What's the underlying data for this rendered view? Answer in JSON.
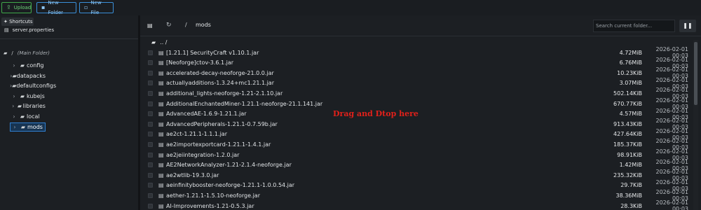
{
  "toolbar": {
    "upload_label": "Upload",
    "new_folder_label": "New Folder",
    "new_file_label": "New File"
  },
  "sidebar": {
    "shortcuts_label": "Shortcuts",
    "shortcut_item": "server.properties",
    "root_label": "/",
    "root_sub": "(Main Folder)",
    "tree": [
      {
        "label": "config"
      },
      {
        "label": "datapacks"
      },
      {
        "label": "defaultconfigs"
      },
      {
        "label": "kubejs"
      },
      {
        "label": "libraries"
      },
      {
        "label": "local"
      },
      {
        "label": "mods",
        "active": true
      }
    ]
  },
  "browser": {
    "crumb_sep": "/",
    "crumb_dir": "mods",
    "search_placeholder": "Search current folder...",
    "up_label": ".. /",
    "drop_hint": "Drag and Dtop here",
    "files": [
      {
        "name": "[1.21.1] SecurityCraft v1.10.1.jar",
        "size": "4.72MiB",
        "date": "2026-02-01 00:03"
      },
      {
        "name": "[Neoforge]ctov-3.6.1.jar",
        "size": "6.76MiB",
        "date": "2026-02-01 00:03"
      },
      {
        "name": "accelerated-decay-neoforge-21.0.0.jar",
        "size": "10.23KiB",
        "date": "2026-02-01 00:03"
      },
      {
        "name": "actuallyadditions-1.3.24+mc1.21.1.jar",
        "size": "3.07MiB",
        "date": "2026-02-01 00:03"
      },
      {
        "name": "additional_lights-neoforge-1.21-2.1.10.jar",
        "size": "502.14KiB",
        "date": "2026-02-01 00:03"
      },
      {
        "name": "AdditionalEnchantedMiner-1.21.1-neoforge-21.1.141.jar",
        "size": "670.77KiB",
        "date": "2026-02-01 00:03"
      },
      {
        "name": "AdvancedAE-1.6.9-1.21.1.jar",
        "size": "4.57MiB",
        "date": "2026-02-01 00:03"
      },
      {
        "name": "AdvancedPeripherals-1.21.1-0.7.59b.jar",
        "size": "913.43KiB",
        "date": "2026-02-01 00:03"
      },
      {
        "name": "ae2ct-1.21.1-1.1.1.jar",
        "size": "427.64KiB",
        "date": "2026-02-01 00:03"
      },
      {
        "name": "ae2importexportcard-1.21.1-1.4.1.jar",
        "size": "185.37KiB",
        "date": "2026-02-01 00:03"
      },
      {
        "name": "ae2jeiintegration-1.2.0.jar",
        "size": "98.91KiB",
        "date": "2026-02-01 00:03"
      },
      {
        "name": "AE2NetworkAnalyzer-1.21-2.1.4-neoforge.jar",
        "size": "1.42MiB",
        "date": "2026-02-01 00:03"
      },
      {
        "name": "ae2wtlib-19.3.0.jar",
        "size": "235.32KiB",
        "date": "2026-02-01 00:03"
      },
      {
        "name": "aeinfinitybooster-neoforge-1.21.1-1.0.0.54.jar",
        "size": "29.7KiB",
        "date": "2026-02-01 00:03"
      },
      {
        "name": "aether-1.21.1-1.5.10-neoforge.jar",
        "size": "38.36MiB",
        "date": "2026-02-01 00:03"
      },
      {
        "name": "AI-Improvements-1.21-0.5.3.jar",
        "size": "28.3KiB",
        "date": "2026-02-01 00:03"
      }
    ]
  }
}
